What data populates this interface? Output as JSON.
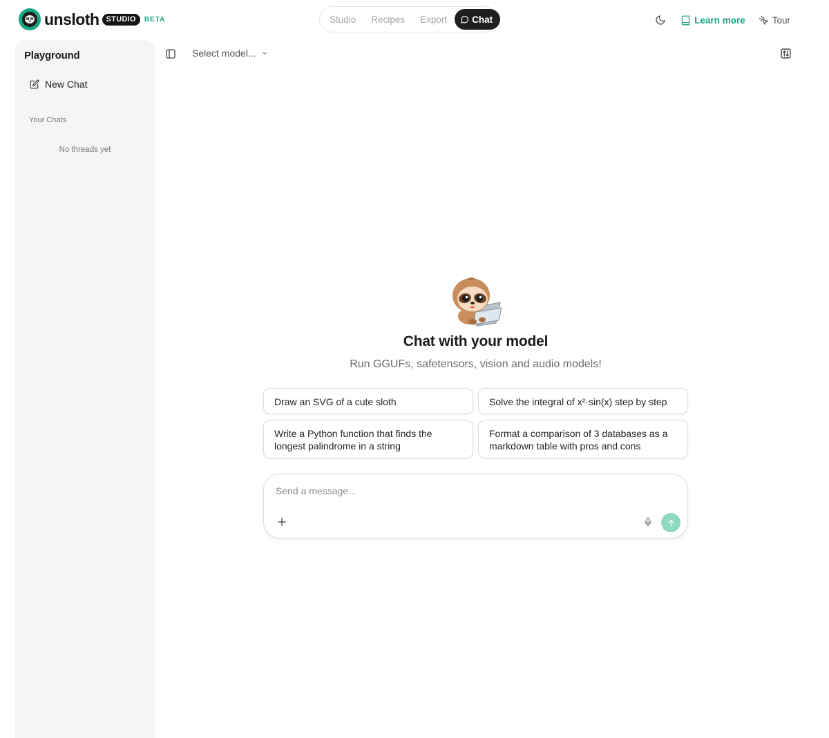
{
  "brand": {
    "name": "unsloth",
    "studio_badge": "STUDIO",
    "beta_badge": "BETA",
    "accent_color": "#1aa884"
  },
  "nav": {
    "tabs": [
      {
        "label": "Studio",
        "active": false
      },
      {
        "label": "Recipes",
        "active": false
      },
      {
        "label": "Export",
        "active": false
      },
      {
        "label": "Chat",
        "active": true
      }
    ]
  },
  "header": {
    "learn_more": "Learn more",
    "tour": "Tour",
    "theme_icon": "moon-icon"
  },
  "sidebar": {
    "title": "Playground",
    "new_chat": "New Chat",
    "section_label": "Your Chats",
    "empty_text": "No threads yet"
  },
  "topbar": {
    "model_placeholder": "Select model..."
  },
  "hero": {
    "title": "Chat with your model",
    "subtitle": "Run GGUFs, safetensors, vision and audio models!"
  },
  "suggestions": [
    "Draw an SVG of a cute sloth",
    "Solve the integral of x²·sin(x) step by step",
    "Write a Python function that finds the longest palindrome in a string",
    "Format a comparison of 3 databases as a markdown table with pros and cons"
  ],
  "composer": {
    "placeholder": "Send a message..."
  }
}
